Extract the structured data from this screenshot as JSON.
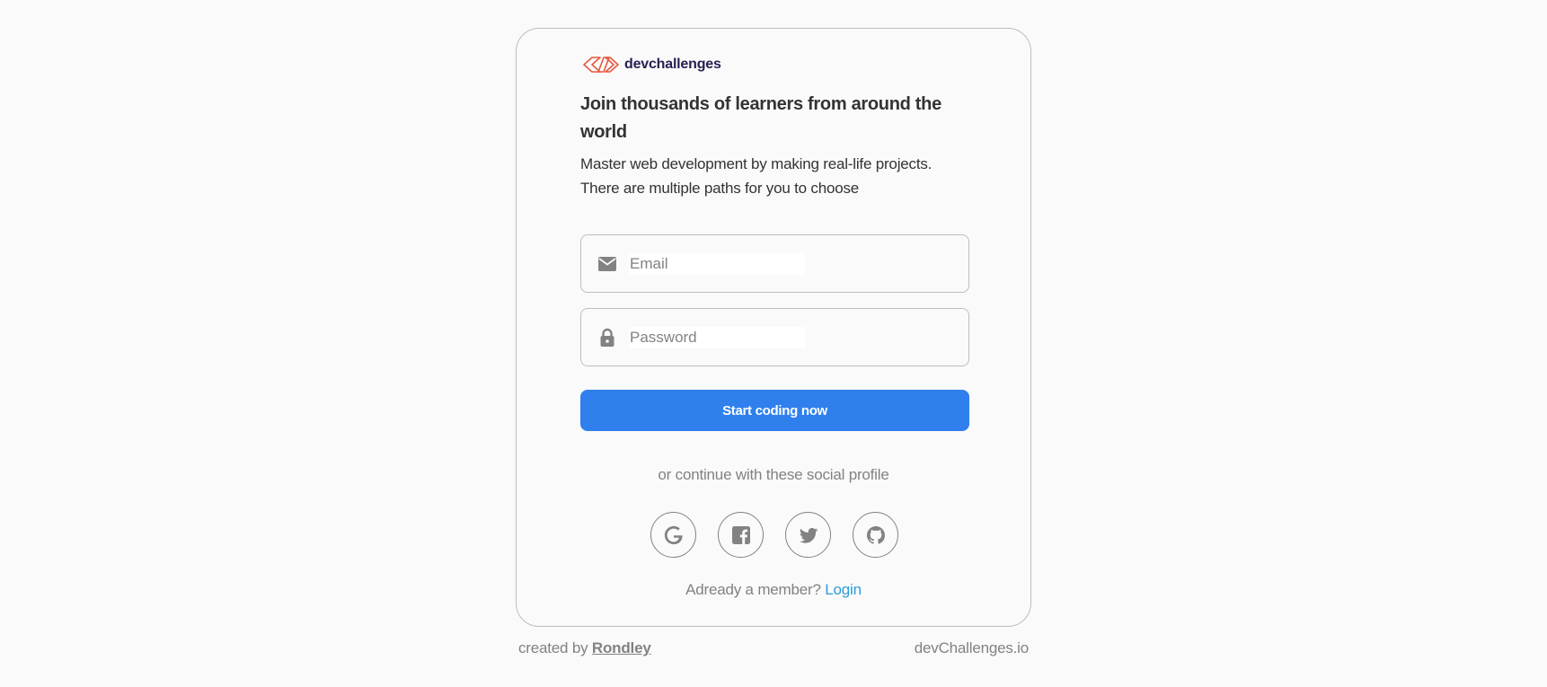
{
  "brand": {
    "name": "devchallenges",
    "logo_icon": "devchallenges-logo"
  },
  "headline": "Join thousands of learners from around the world",
  "subtext": "Master web development by making real-life projects. There are multiple paths for you to choose",
  "form": {
    "email": {
      "placeholder": "Email",
      "value": "",
      "icon": "mail-icon"
    },
    "password": {
      "placeholder": "Password",
      "value": "",
      "icon": "lock-icon"
    },
    "submit_label": "Start coding now"
  },
  "social": {
    "prompt": "or continue with these social profile",
    "providers": [
      {
        "name": "Google",
        "icon": "google-icon"
      },
      {
        "name": "Facebook",
        "icon": "facebook-icon"
      },
      {
        "name": "Twitter",
        "icon": "twitter-icon"
      },
      {
        "name": "GitHub",
        "icon": "github-icon"
      }
    ]
  },
  "member": {
    "text": "Adready a member?",
    "login_label": "Login"
  },
  "footer": {
    "created_by": "created by",
    "author": "Rondley",
    "site": "devChallenges.io"
  },
  "colors": {
    "primary": "#2f80ed",
    "link": "#2d9cdb",
    "brand_text": "#282051",
    "logo_red": "#e8583f",
    "muted": "#828282",
    "border": "#bdbdbd"
  }
}
